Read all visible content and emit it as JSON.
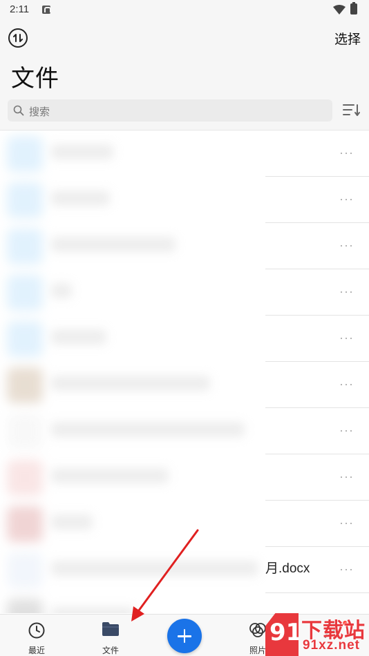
{
  "status_bar": {
    "time": "2:11"
  },
  "header": {
    "title": "文件",
    "select_label": "选择"
  },
  "search": {
    "placeholder": "搜索"
  },
  "file_list": {
    "rows": [
      {
        "thumb_color": "#bfe3fb",
        "name_width": 90
      },
      {
        "thumb_color": "#bfe3fb",
        "name_width": 85
      },
      {
        "thumb_color": "#bfe3fb",
        "name_width": 180
      },
      {
        "thumb_color": "#bfe3fb",
        "name_width": 30
      },
      {
        "thumb_color": "#bfe3fb",
        "name_width": 80
      },
      {
        "thumb_color": "#cdb79e",
        "name_width": 230
      },
      {
        "thumb_color": "#f1f1f1",
        "name_width": 280
      },
      {
        "thumb_color": "#f3c8c8",
        "name_width": 170
      },
      {
        "thumb_color": "#e0a3a3",
        "name_width": 60
      },
      {
        "thumb_color": "#e4ecf8",
        "name_width": 300,
        "visible_suffix": "月.docx"
      },
      {
        "thumb_color": "#bdbdbd",
        "name_width": 120
      }
    ],
    "more_label": "···"
  },
  "bottom_nav": {
    "items": [
      {
        "label": "最近",
        "icon": "clock-icon"
      },
      {
        "label": "文件",
        "icon": "folder-icon"
      },
      {
        "label": "",
        "icon": "plus-icon"
      },
      {
        "label": "照片",
        "icon": "photos-icon"
      },
      {
        "label": "",
        "icon": "profile-icon"
      }
    ]
  },
  "watermark": {
    "title": "下载站",
    "url": "91xz.net",
    "logo": "91"
  },
  "colors": {
    "accent": "#1a73e8",
    "badge": "#ff3b30",
    "watermark": "#e8383d",
    "arrow": "#e02020"
  }
}
